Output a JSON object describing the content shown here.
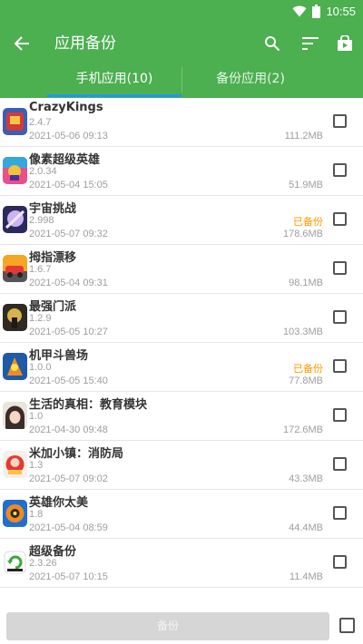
{
  "status_bar": {
    "time": "10:55",
    "icons": [
      "wifi-icon",
      "battery-icon"
    ]
  },
  "app_bar": {
    "title": "应用备份",
    "actions": [
      "search-icon",
      "sort-icon",
      "store-icon"
    ]
  },
  "tabs": [
    {
      "label": "手机应用(10)",
      "active": true
    },
    {
      "label": "备份应用(2)",
      "active": false
    }
  ],
  "apps": [
    {
      "name": "CrazyKings",
      "version": "2.4.7",
      "date": "2021-05-06 09:13",
      "size": "111.2MB",
      "backed_up": ""
    },
    {
      "name": "像素超级英雄",
      "version": "2.0.34",
      "date": "2021-05-04 15:05",
      "size": "51.9MB",
      "backed_up": ""
    },
    {
      "name": "宇宙挑战",
      "version": "2.998",
      "date": "2021-05-07 09:32",
      "size": "178.6MB",
      "backed_up": "已备份"
    },
    {
      "name": "拇指漂移",
      "version": "1.6.7",
      "date": "2021-05-04 09:31",
      "size": "98.1MB",
      "backed_up": ""
    },
    {
      "name": "最强门派",
      "version": "1.2.9",
      "date": "2021-05-05 10:27",
      "size": "103.3MB",
      "backed_up": ""
    },
    {
      "name": "机甲斗兽场",
      "version": "1.0.0",
      "date": "2021-05-05 15:40",
      "size": "77.8MB",
      "backed_up": "已备份"
    },
    {
      "name": "生活的真相：教育模块",
      "version": "1.0",
      "date": "2021-04-30 09:48",
      "size": "172.6MB",
      "backed_up": ""
    },
    {
      "name": "米加小镇：消防局",
      "version": "1.3",
      "date": "2021-05-07 09:02",
      "size": "43.3MB",
      "backed_up": ""
    },
    {
      "name": "英雄你太美",
      "version": "1.8",
      "date": "2021-05-04 08:59",
      "size": "44.4MB",
      "backed_up": ""
    },
    {
      "name": "超级备份",
      "version": "2.3.26",
      "date": "2021-05-07 10:15",
      "size": "11.4MB",
      "backed_up": ""
    }
  ],
  "bottom": {
    "backup_label": "备份"
  },
  "colors": {
    "primary": "#4caf50",
    "accent": "#2196f3",
    "backed": "#ff9800"
  }
}
